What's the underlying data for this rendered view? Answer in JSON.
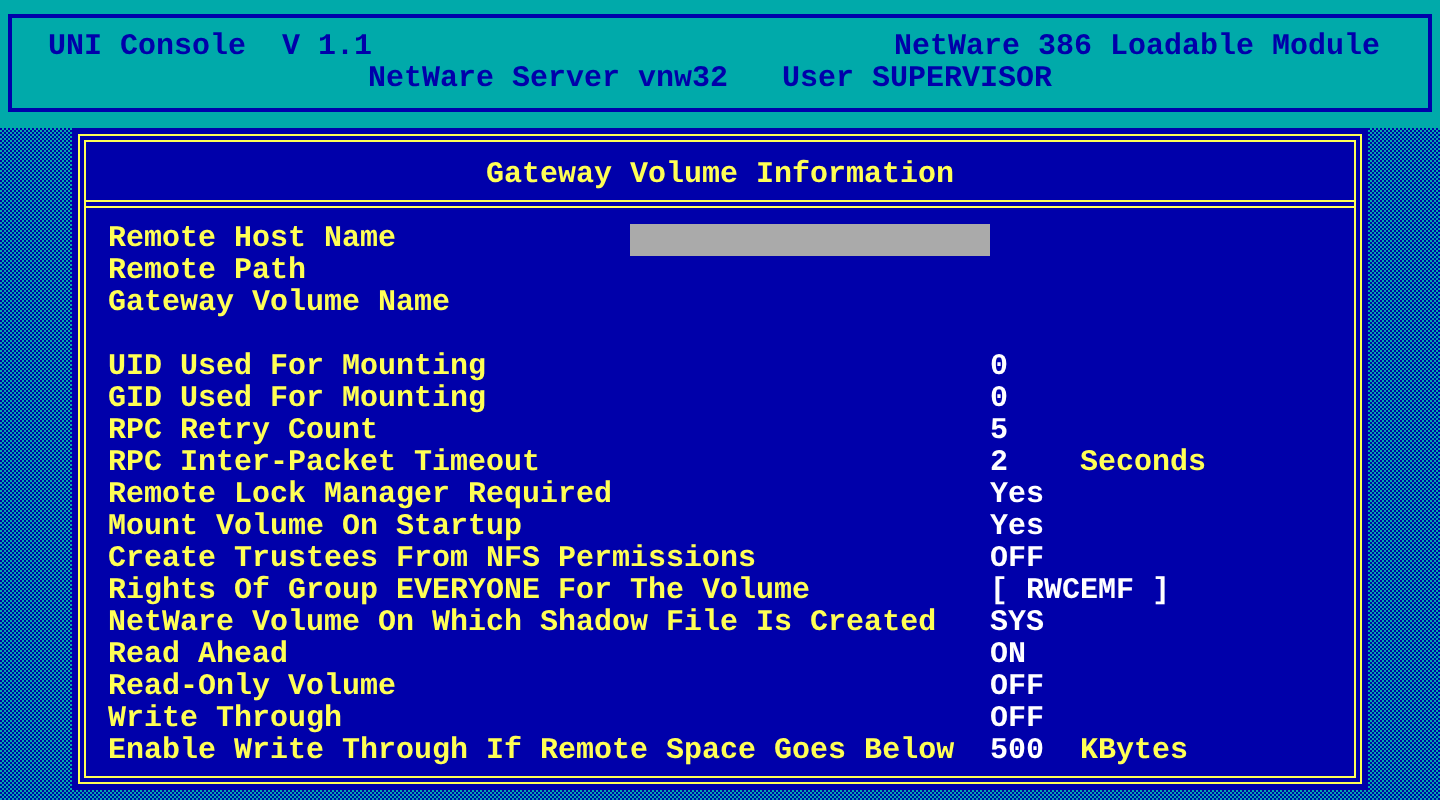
{
  "header": {
    "title": "UNI Console  V 1.1",
    "module": "NetWare 386 Loadable Module",
    "server": "NetWare Server vnw32   User SUPERVISOR"
  },
  "dialog": {
    "title": "Gateway Volume Information",
    "sections": [
      {
        "rows": [
          {
            "label": "Remote Host Name",
            "selected": true
          },
          {
            "label": "Remote Path",
            "selected": false
          },
          {
            "label": "Gateway Volume Name",
            "selected": false
          }
        ]
      },
      {
        "rows": [
          {
            "label": "UID Used For Mounting",
            "value": "0",
            "selected": false
          },
          {
            "label": "GID Used For Mounting",
            "value": "0",
            "selected": false
          },
          {
            "label": "RPC Retry Count",
            "value": "5",
            "selected": false
          },
          {
            "label": "RPC Inter-Packet Timeout",
            "value": "2",
            "unit": "Seconds",
            "selected": false
          },
          {
            "label": "Remote Lock Manager Required",
            "value": "Yes",
            "selected": false
          },
          {
            "label": "Mount Volume On Startup",
            "value": "Yes",
            "selected": false
          },
          {
            "label": "Create Trustees From NFS Permissions",
            "value": "OFF",
            "selected": false
          },
          {
            "label": "Rights Of Group EVERYONE For The Volume",
            "value": "[ RWCEMF ]",
            "selected": false
          },
          {
            "label": "NetWare Volume On Which Shadow File Is Created",
            "value": "SYS",
            "selected": false
          },
          {
            "label": "Read Ahead",
            "value": "ON",
            "selected": false
          },
          {
            "label": "Read-Only Volume",
            "value": "OFF",
            "selected": false
          },
          {
            "label": "Write Through",
            "value": "OFF",
            "selected": false
          },
          {
            "label": "Enable Write Through If Remote Space Goes Below",
            "value": "500",
            "unit": "KBytes",
            "selected": false
          }
        ]
      }
    ]
  }
}
